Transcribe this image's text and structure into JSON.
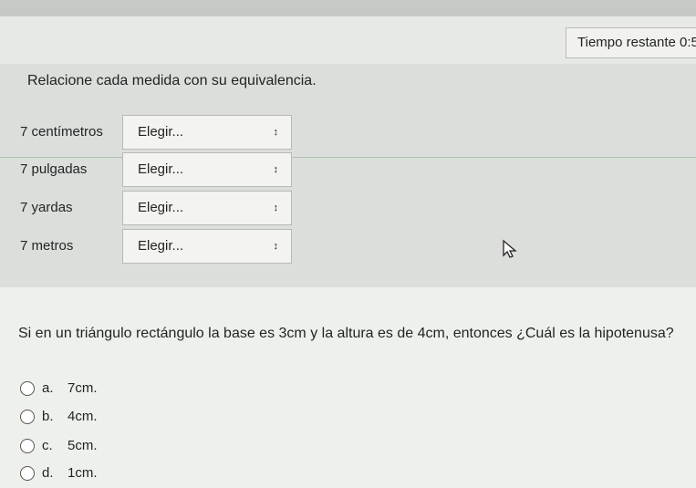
{
  "timer": {
    "label": "Tiempo restante 0:5"
  },
  "question1": {
    "prompt": "Relacione cada medida con su equivalencia.",
    "rows": [
      {
        "label": "7 centímetros",
        "select": "Elegir..."
      },
      {
        "label": "7 pulgadas",
        "select": "Elegir..."
      },
      {
        "label": "7 yardas",
        "select": "Elegir..."
      },
      {
        "label": "7 metros",
        "select": "Elegir..."
      }
    ]
  },
  "question2": {
    "prompt": "Si en un triángulo rectángulo la base es 3cm y la altura es de 4cm, entonces ¿Cuál es la hipotenusa?",
    "options": [
      {
        "letter": "a.",
        "text": "7cm."
      },
      {
        "letter": "b.",
        "text": "4cm."
      },
      {
        "letter": "c.",
        "text": "5cm."
      },
      {
        "letter": "d.",
        "text": "1cm."
      }
    ]
  }
}
